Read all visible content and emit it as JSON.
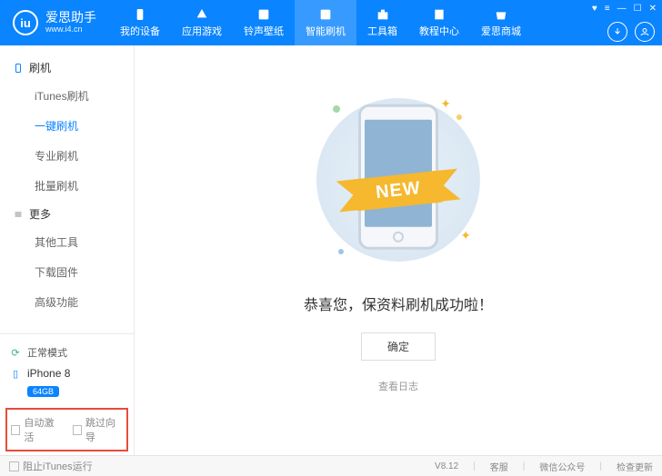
{
  "brand": {
    "logo_text": "iu",
    "title": "爱思助手",
    "url": "www.i4.cn"
  },
  "top_tabs": [
    {
      "label": "我的设备"
    },
    {
      "label": "应用游戏"
    },
    {
      "label": "铃声壁纸"
    },
    {
      "label": "智能刷机"
    },
    {
      "label": "工具箱"
    },
    {
      "label": "教程中心"
    },
    {
      "label": "爱思商城"
    }
  ],
  "sidebar": {
    "group1": {
      "title": "刷机",
      "items": [
        "iTunes刷机",
        "一键刷机",
        "专业刷机",
        "批量刷机"
      ]
    },
    "group2": {
      "title": "更多",
      "items": [
        "其他工具",
        "下载固件",
        "高级功能"
      ]
    },
    "mode": "正常模式",
    "device": {
      "name": "iPhone 8",
      "storage": "64GB"
    },
    "checks": {
      "auto_activate": "自动激活",
      "skip_guide": "跳过向导"
    }
  },
  "main": {
    "ribbon": "NEW",
    "title": "恭喜您，保资料刷机成功啦！",
    "ok": "确定",
    "log": "查看日志"
  },
  "footer": {
    "block_itunes": "阻止iTunes运行",
    "version": "V8.12",
    "service": "客服",
    "wechat": "微信公众号",
    "update": "检查更新"
  }
}
